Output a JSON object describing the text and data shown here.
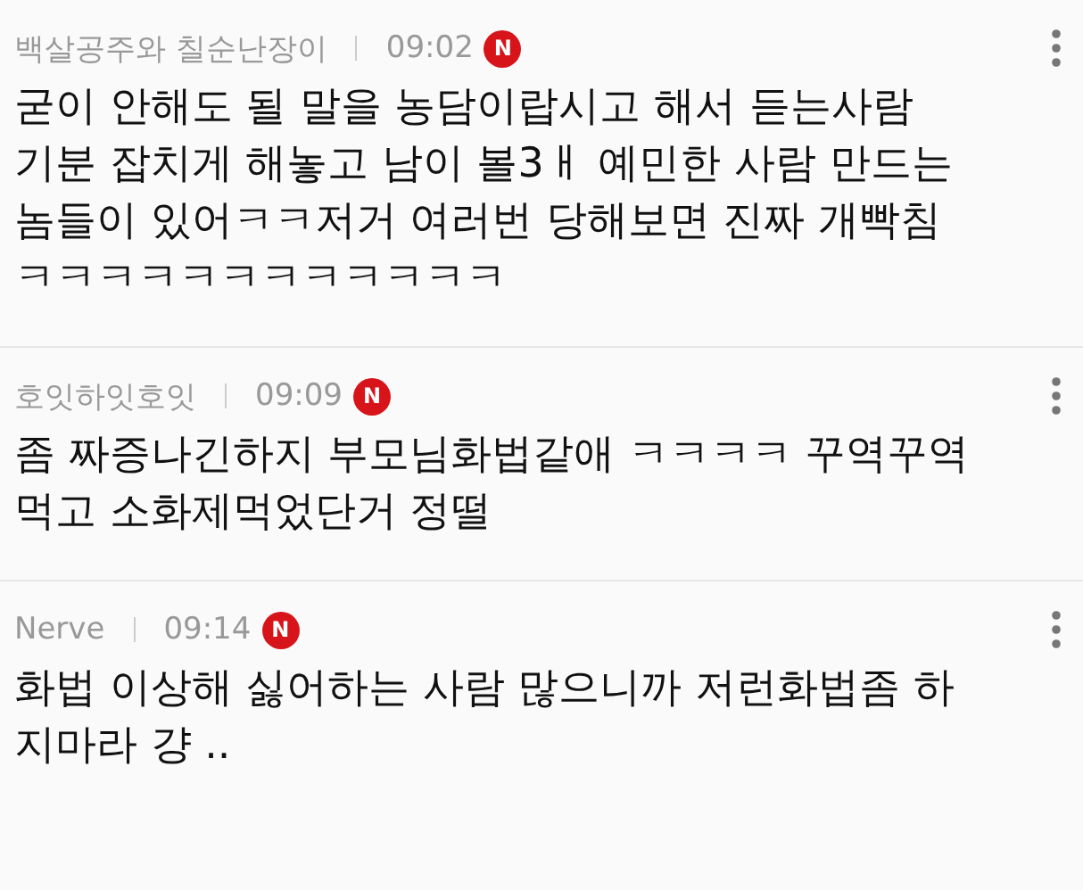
{
  "comments": [
    {
      "author": "백살공주와 칠순난장이",
      "time": "09:02",
      "badge": "N",
      "lines": [
        "굳이 안해도 될 말을 농담이랍시고 해서 듣는사람",
        "기분 잡치게 해놓고 남이 볼3ㅐ 예민한 사람 만드는",
        "놈들이 있어ㅋㅋ저거 여러번 당해보면 진짜 개빡침",
        "ㅋㅋㅋㅋㅋㅋㅋㅋㅋㅋㅋㅋ"
      ]
    },
    {
      "author": "호잇하잇호잇",
      "time": "09:09",
      "badge": "N",
      "lines": [
        "좀 짜증나긴하지 부모님화법같애 ㅋㅋㅋㅋ 꾸역꾸역",
        "먹고 소화제먹었단거 정떨"
      ]
    },
    {
      "author": "Nerve",
      "time": "09:14",
      "badge": "N",
      "lines": [
        "화법 이상해 싫어하는 사람 많으니까 저런화법좀 하",
        "지마라 걍 .."
      ]
    }
  ]
}
